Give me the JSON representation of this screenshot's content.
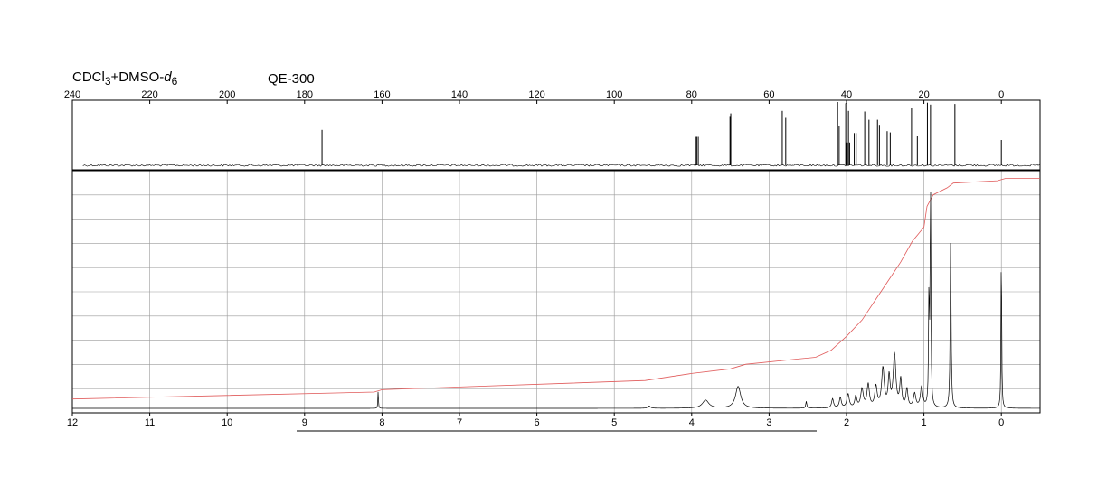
{
  "header": {
    "solvent_parts": [
      "CDCl",
      "3",
      "+DMSO-",
      "d",
      "6"
    ],
    "instrument": "QE-300"
  },
  "chart_data": [
    {
      "type": "line",
      "nucleus": "13C",
      "x_ticks": [
        "240",
        "220",
        "200",
        "180",
        "160",
        "140",
        "120",
        "100",
        "80",
        "60",
        "40",
        "20",
        "0"
      ],
      "xlim": [
        240,
        -10
      ],
      "grid": false,
      "peaks": [
        {
          "x": 175.5,
          "h": 0.56
        },
        {
          "x": 79.0,
          "h": 0.45
        },
        {
          "x": 78.7,
          "h": 0.45
        },
        {
          "x": 78.3,
          "h": 0.45
        },
        {
          "x": 70.1,
          "h": 0.78
        },
        {
          "x": 69.9,
          "h": 0.82
        },
        {
          "x": 56.6,
          "h": 0.86
        },
        {
          "x": 55.7,
          "h": 0.75
        },
        {
          "x": 42.3,
          "h": 1.0
        },
        {
          "x": 41.9,
          "h": 0.62
        },
        {
          "x": 40.2,
          "h": 0.98
        },
        {
          "x": 40.0,
          "h": 0.36
        },
        {
          "x": 39.8,
          "h": 0.36
        },
        {
          "x": 39.5,
          "h": 0.86
        },
        {
          "x": 39.2,
          "h": 0.36
        },
        {
          "x": 38.0,
          "h": 0.51
        },
        {
          "x": 37.5,
          "h": 0.51
        },
        {
          "x": 35.3,
          "h": 0.85
        },
        {
          "x": 34.2,
          "h": 0.72
        },
        {
          "x": 32.0,
          "h": 0.72
        },
        {
          "x": 31.5,
          "h": 0.64
        },
        {
          "x": 29.5,
          "h": 0.54
        },
        {
          "x": 28.7,
          "h": 0.52
        },
        {
          "x": 23.2,
          "h": 0.91
        },
        {
          "x": 21.7,
          "h": 0.46
        },
        {
          "x": 19.1,
          "h": 0.99
        },
        {
          "x": 18.3,
          "h": 0.96
        },
        {
          "x": 12.0,
          "h": 0.97
        },
        {
          "x": 0.0,
          "h": 0.4
        }
      ]
    },
    {
      "type": "line",
      "nucleus": "1H",
      "x_ticks": [
        "12",
        "11",
        "10",
        "9",
        "8",
        "7",
        "6",
        "5",
        "4",
        "3",
        "2",
        "1",
        "0"
      ],
      "xlim": [
        12,
        -0.5
      ],
      "grid": true,
      "peaks": [
        {
          "x": 8.05,
          "h": 0.08,
          "w": 0.004
        },
        {
          "x": 4.55,
          "h": 0.01,
          "w": 0.02
        },
        {
          "x": 3.82,
          "h": 0.035,
          "w": 0.05
        },
        {
          "x": 3.4,
          "h": 0.095,
          "w": 0.04
        },
        {
          "x": 2.52,
          "h": 0.03,
          "w": 0.008
        },
        {
          "x": 2.18,
          "h": 0.04,
          "w": 0.015
        },
        {
          "x": 2.08,
          "h": 0.045,
          "w": 0.015
        },
        {
          "x": 1.98,
          "h": 0.06,
          "w": 0.018
        },
        {
          "x": 1.88,
          "h": 0.05,
          "w": 0.015
        },
        {
          "x": 1.8,
          "h": 0.08,
          "w": 0.02
        },
        {
          "x": 1.72,
          "h": 0.1,
          "w": 0.018
        },
        {
          "x": 1.62,
          "h": 0.09,
          "w": 0.018
        },
        {
          "x": 1.53,
          "h": 0.17,
          "w": 0.02
        },
        {
          "x": 1.45,
          "h": 0.13,
          "w": 0.015
        },
        {
          "x": 1.38,
          "h": 0.23,
          "w": 0.02
        },
        {
          "x": 1.3,
          "h": 0.12,
          "w": 0.015
        },
        {
          "x": 1.22,
          "h": 0.08,
          "w": 0.015
        },
        {
          "x": 1.12,
          "h": 0.06,
          "w": 0.018
        },
        {
          "x": 1.03,
          "h": 0.09,
          "w": 0.018
        },
        {
          "x": 0.935,
          "h": 0.5,
          "w": 0.006
        },
        {
          "x": 0.915,
          "h": 0.95,
          "w": 0.006
        },
        {
          "x": 0.655,
          "h": 0.75,
          "w": 0.007
        },
        {
          "x": 0.0,
          "h": 0.72,
          "w": 0.005
        }
      ],
      "integral": [
        [
          12.0,
          0.04
        ],
        [
          8.1,
          0.07
        ],
        [
          8.0,
          0.08
        ],
        [
          4.6,
          0.12
        ],
        [
          4.0,
          0.15
        ],
        [
          3.5,
          0.17
        ],
        [
          3.3,
          0.19
        ],
        [
          2.7,
          0.21
        ],
        [
          2.4,
          0.22
        ],
        [
          2.2,
          0.25
        ],
        [
          2.0,
          0.31
        ],
        [
          1.8,
          0.38
        ],
        [
          1.6,
          0.48
        ],
        [
          1.4,
          0.58
        ],
        [
          1.3,
          0.63
        ],
        [
          1.15,
          0.72
        ],
        [
          1.0,
          0.78
        ],
        [
          0.96,
          0.87
        ],
        [
          0.88,
          0.92
        ],
        [
          0.7,
          0.95
        ],
        [
          0.62,
          0.97
        ],
        [
          0.05,
          0.98
        ],
        [
          -0.05,
          0.99
        ],
        [
          -0.5,
          0.99
        ]
      ]
    }
  ]
}
